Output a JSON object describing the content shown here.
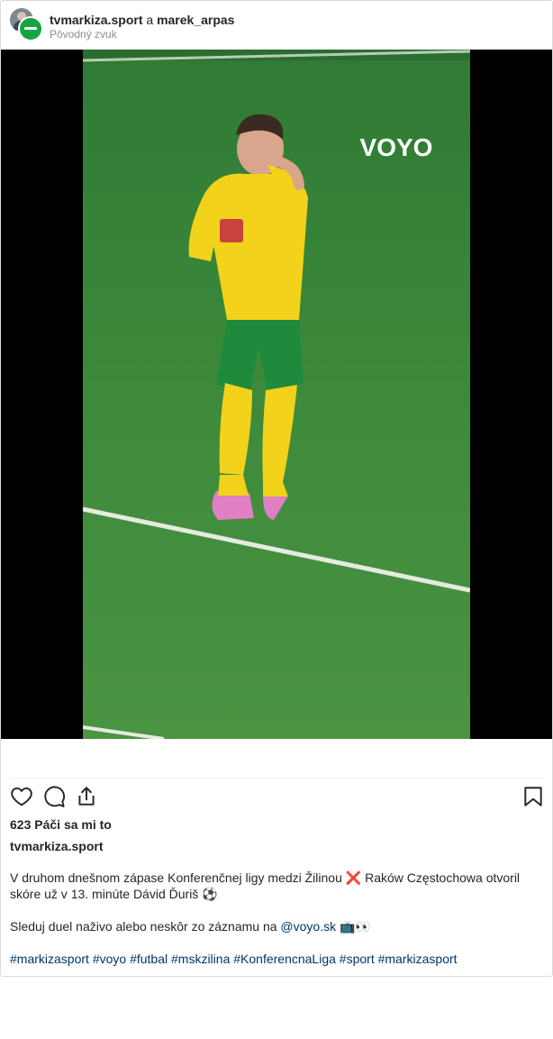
{
  "header": {
    "account_primary": "tvmarkiza.sport",
    "joiner": "a",
    "account_secondary": "marek_arpas",
    "audio_label": "Pôvodný zvuk"
  },
  "video": {
    "watermark": "VOYO"
  },
  "post": {
    "likes": "623 Páči sa mi to",
    "author": "tvmarkiza.sport",
    "caption_line1": "V druhom dnešnom zápase Konferenčnej ligy medzi Žilinou ❌ Raków Częstochowa otvoril skóre už v 13. minúte Dávid Ďuriš ⚽",
    "caption_line2_text": "Sleduj duel naživo alebo neskôr zo záznamu na",
    "caption_line2_link": "@voyo.sk",
    "caption_line2_emoji": "📺👀",
    "hashtags": [
      "#markizasport",
      "#voyo",
      "#futbal",
      "#mskzilina",
      "#KonferencnaLiga",
      "#sport",
      "#markizasport"
    ]
  },
  "icons": {
    "like": "heart-icon",
    "comment": "comment-icon",
    "share": "share-icon",
    "save": "bookmark-icon"
  },
  "colors": {
    "link": "#00376b",
    "muted": "#8e8e8e",
    "border": "#dbdbdb",
    "pitch": "#3f8a3a",
    "jersey": "#f2d21a",
    "shorts": "#1f8a3b"
  }
}
